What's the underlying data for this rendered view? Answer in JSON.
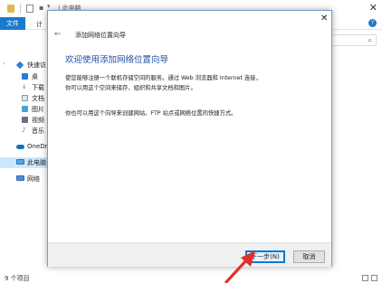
{
  "explorer": {
    "title": "| 此电脑",
    "ribbon": {
      "file_tab": "文件",
      "computer_tab": "计"
    },
    "nav": {
      "quick_access": "快速访",
      "desktop": "桌",
      "downloads": "下载",
      "documents": "文档",
      "pictures": "图片",
      "videos": "视频",
      "music": "音乐",
      "onedrive": "OneDri",
      "this_pc": "此电脑",
      "network": "网络"
    },
    "status": "9 个项目"
  },
  "dialog": {
    "window_title": "添加网络位置向导",
    "heading": "欢迎使用添加网络位置向导",
    "body": "使您能够注册一个联机存储空间的服务。通过 Web 浏览器和 Internet 连接，你可以用这个空间来储存、组织和共享文档和图片。",
    "body2": "你也可以用这个向导来创建网站、FTP 站点或网络位置的快捷方式。",
    "next_button": "下一步(N)",
    "cancel_button": "取消"
  },
  "colors": {
    "accent": "#1979ca",
    "heading": "#1e4fa3",
    "selection": "#cce8ff",
    "annotation_arrow": "#e0312a"
  },
  "icons": {
    "close": "close-icon",
    "back": "back-arrow-icon",
    "search": "search-icon",
    "help": "help-icon"
  }
}
